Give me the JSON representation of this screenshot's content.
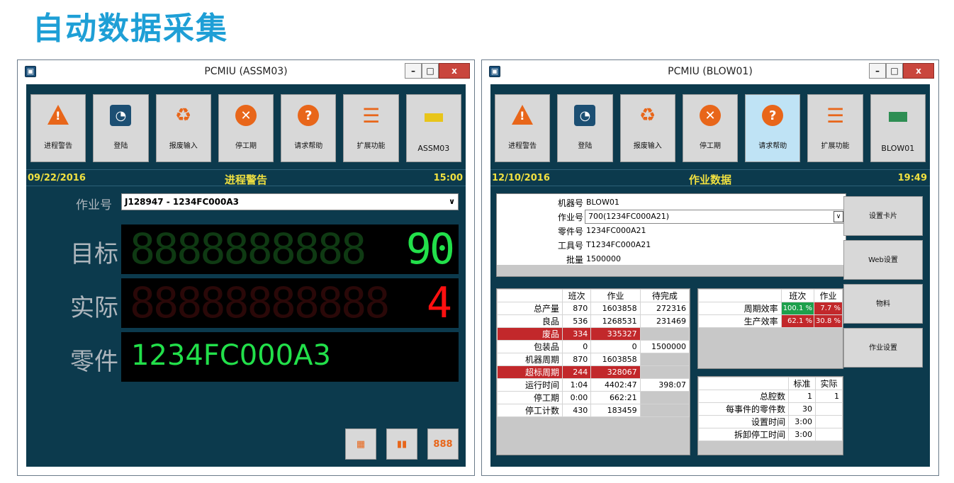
{
  "page_title": "自动数据采集",
  "w1": {
    "title": "PCMIU (ASSM03)",
    "toolbar": [
      "进程警告",
      "登陆",
      "报废输入",
      "停工期",
      "请求帮助",
      "扩展功能",
      "ASSM03"
    ],
    "status": {
      "date": "09/22/2016",
      "center": "进程警告",
      "time": "15:00"
    },
    "job_label": "作业号",
    "job_value": "J128947 - 1234FC000A3",
    "target_label": "目标",
    "target_ghost": "8888888888",
    "target_value": "90",
    "actual_label": "实际",
    "actual_ghost": "88888888888",
    "actual_value": "4",
    "part_label": "零件",
    "part_value": "1234FC000A3",
    "bottom_btn_3": "888"
  },
  "w2": {
    "title": "PCMIU (BLOW01)",
    "toolbar": [
      "进程警告",
      "登陆",
      "报废输入",
      "停工期",
      "请求帮助",
      "扩展功能",
      "BLOW01"
    ],
    "status": {
      "date": "12/10/2016",
      "center": "作业数据",
      "time": "19:49"
    },
    "info": [
      {
        "k": "机器号",
        "v": "BLOW01"
      },
      {
        "k": "作业号",
        "v": "700(1234FC000A21)"
      },
      {
        "k": "零件号",
        "v": "1234FC000A21"
      },
      {
        "k": "工具号",
        "v": "T1234FC000A21"
      },
      {
        "k": "批量",
        "v": "1500000"
      }
    ],
    "side_buttons": [
      "设置卡片",
      "Web设置",
      "物料",
      "作业设置"
    ],
    "prod_table": {
      "headers": [
        "班次",
        "作业",
        "待完成"
      ],
      "rows": [
        {
          "k": "总产量",
          "a": "870",
          "b": "1603858",
          "c": "272316"
        },
        {
          "k": "良品",
          "a": "536",
          "b": "1268531",
          "c": "231469"
        },
        {
          "k": "废品",
          "a": "334",
          "b": "335327",
          "c": ""
        },
        {
          "k": "包装品",
          "a": "0",
          "b": "0",
          "c": "1500000"
        },
        {
          "k": "机器周期",
          "a": "870",
          "b": "1603858",
          "c": ""
        },
        {
          "k": "超标周期",
          "a": "244",
          "b": "328067",
          "c": ""
        },
        {
          "k": "运行时间",
          "a": "1:04",
          "b": "4402:47",
          "c": "398:07"
        },
        {
          "k": "停工期",
          "a": "0:00",
          "b": "662:21",
          "c": ""
        },
        {
          "k": "停工计数",
          "a": "430",
          "b": "183459",
          "c": ""
        }
      ]
    },
    "eff_table": {
      "headers": [
        "班次",
        "作业"
      ],
      "rows": [
        {
          "k": "周期效率",
          "a": "100.1 %",
          "b": "7.7 %"
        },
        {
          "k": "生产效率",
          "a": "62.1 %",
          "b": "30.8 %"
        }
      ]
    },
    "cavity_table": {
      "headers": [
        "标准",
        "实际"
      ],
      "rows": [
        {
          "k": "总腔数",
          "a": "1",
          "b": "1"
        },
        {
          "k": "每事件的零件数",
          "a": "30",
          "b": ""
        },
        {
          "k": "设置时间",
          "a": "3:00",
          "b": ""
        },
        {
          "k": "拆卸停工时间",
          "a": "3:00",
          "b": ""
        }
      ]
    }
  }
}
